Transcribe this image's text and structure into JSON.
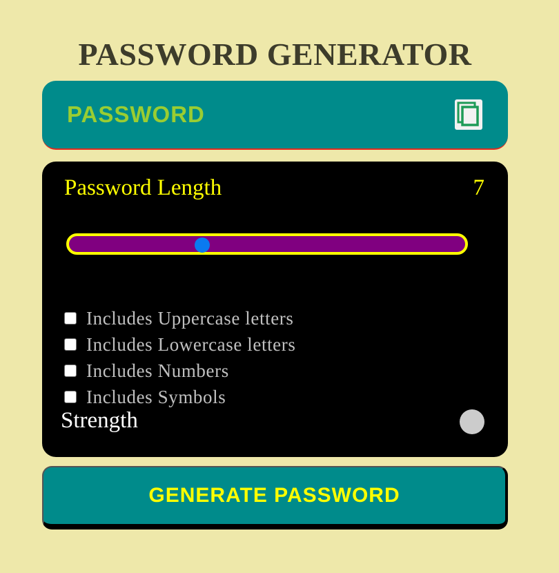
{
  "app": {
    "title": "PASSWORD GENERATOR"
  },
  "display": {
    "password_text": "PASSWORD",
    "copy_icon": "copy-icon"
  },
  "length": {
    "label": "Password Length",
    "value": "7",
    "slider_fraction": 0.33
  },
  "options": [
    {
      "label": "Includes Uppercase letters",
      "checked": false
    },
    {
      "label": "Includes Lowercase letters",
      "checked": false
    },
    {
      "label": "Includes Numbers",
      "checked": false
    },
    {
      "label": "Includes Symbols",
      "checked": false
    }
  ],
  "strength": {
    "label": "Strength",
    "indicator_color": "#cccccc"
  },
  "generate": {
    "label": "GENERATE PASSWORD"
  },
  "colors": {
    "background": "#eee8aa",
    "accent_teal": "#008b8b",
    "accent_yellow": "#ffff00",
    "slider_track": "#800080",
    "slider_thumb": "#0a7af0"
  }
}
